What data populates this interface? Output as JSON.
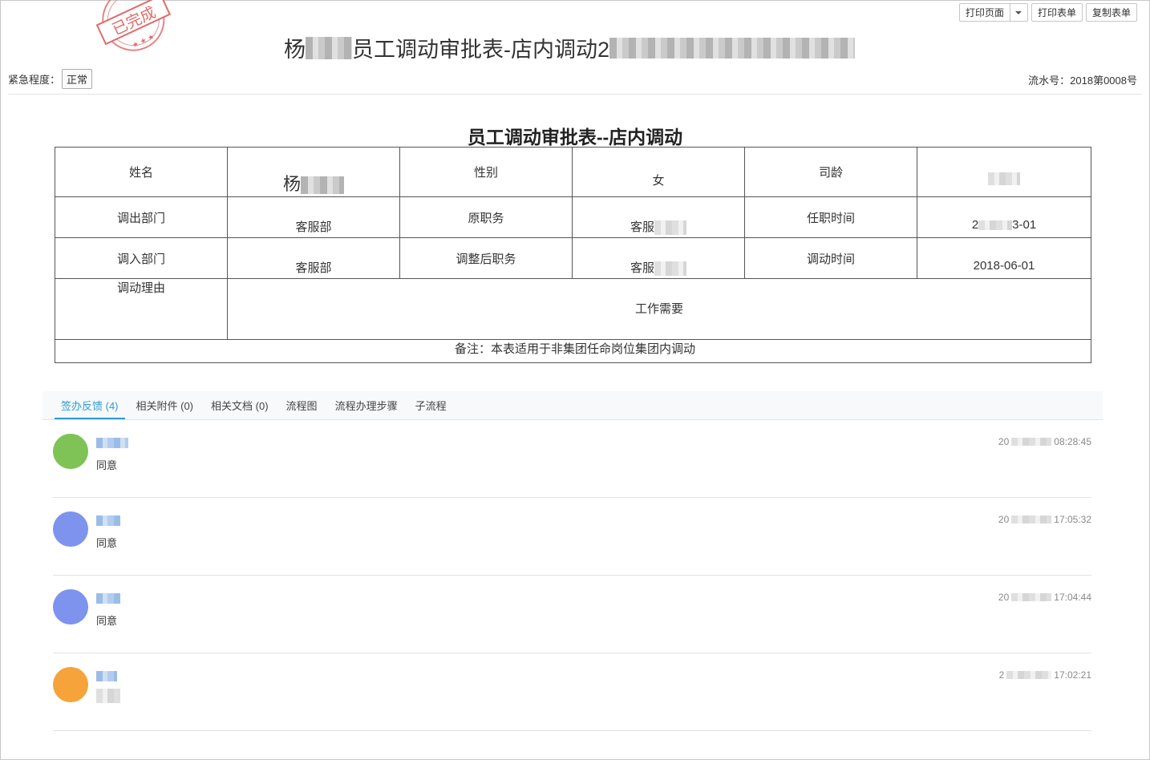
{
  "toolbar": {
    "print_page": "打印页面",
    "print_form": "打印表单",
    "copy_form": "复制表单"
  },
  "stamp": {
    "text": "已完成",
    "color": "#e06a6a"
  },
  "header": {
    "title_prefix": "杨",
    "title_middle": "员工调动审批表-店内调动2",
    "urgency_label": "紧急程度：",
    "urgency_value": "正常",
    "serial_label": "流水号：",
    "serial_value": "2018第0008号"
  },
  "form": {
    "title": "员工调动审批表--店内调动",
    "labels": {
      "name": "姓名",
      "gender": "性别",
      "seniority": "司龄",
      "from_dept": "调出部门",
      "orig_position": "原职务",
      "appoint_time": "任职时间",
      "to_dept": "调入部门",
      "new_position": "调整后职务",
      "transfer_time": "调动时间",
      "reason": "调动理由"
    },
    "values": {
      "name_prefix": "杨",
      "gender": "女",
      "from_dept": "客服部",
      "orig_position_prefix": "客服",
      "appoint_time_prefix": "2",
      "appoint_time_suffix": "3-01",
      "to_dept": "客服部",
      "new_position_prefix": "客服",
      "transfer_time": "2018-06-01",
      "reason": "工作需要"
    },
    "remark": "备注：本表适用于非集团任命岗位集团内调动"
  },
  "tabs": [
    {
      "label": "签办反馈 (4)",
      "active": true
    },
    {
      "label": "相关附件 (0)",
      "active": false
    },
    {
      "label": "相关文档 (0)",
      "active": false
    },
    {
      "label": "流程图",
      "active": false
    },
    {
      "label": "流程办理步骤",
      "active": false
    },
    {
      "label": "子流程",
      "active": false
    }
  ],
  "feedback": [
    {
      "opinion": "同意",
      "time_prefix": "20",
      "time": "08:28:45",
      "avatar_color": "#7fc356"
    },
    {
      "opinion": "同意",
      "time_prefix": "20",
      "time": "17:05:32",
      "avatar_color": "#7d93ee"
    },
    {
      "opinion": "同意",
      "time_prefix": "20",
      "time": "17:04:44",
      "avatar_color": "#7d93ee"
    },
    {
      "opinion": "",
      "time_prefix": "2",
      "time": "17:02:21",
      "avatar_color": "#f5a33a"
    }
  ]
}
